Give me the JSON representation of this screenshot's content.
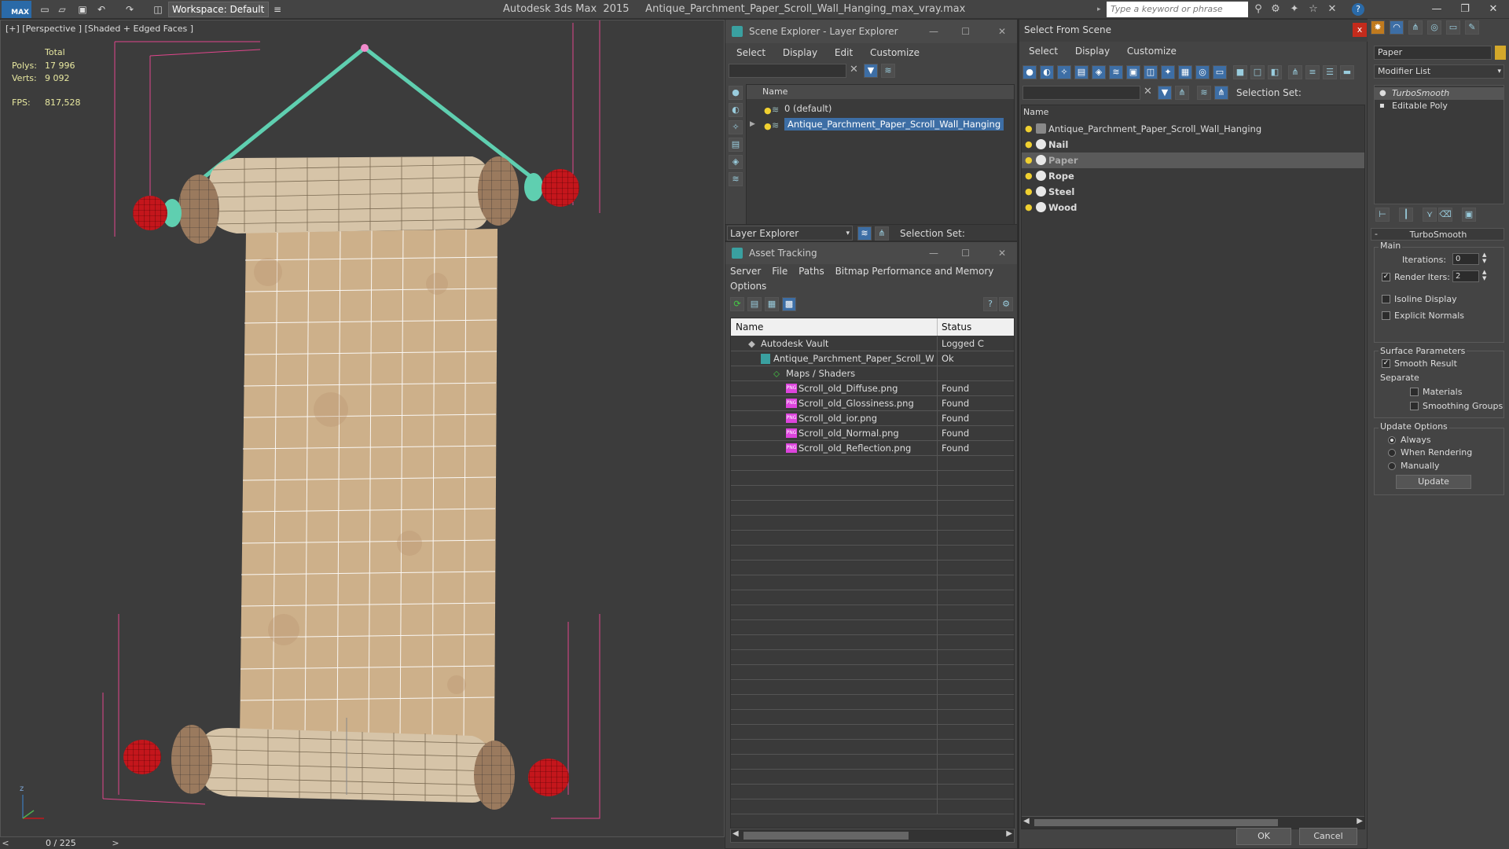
{
  "titlebar": {
    "logo": "MAX",
    "workspace": "Workspace: Default",
    "title": "Autodesk 3ds Max  2015     Antique_Parchment_Paper_Scroll_Wall_Hanging_max_vray.max",
    "search_placeholder": "Type a keyword or phrase"
  },
  "viewport": {
    "label": "[+] [Perspective ] [Shaded + Edged Faces ]",
    "stats": {
      "total_label": "Total",
      "polys_label": "Polys:",
      "polys_value": "17 996",
      "verts_label": "Verts:",
      "verts_value": "9 092",
      "fps_label": "FPS:",
      "fps_value": "817,528"
    },
    "axis_z": "z",
    "timeline_frame": "0 / 225",
    "timeline_prev": "<",
    "timeline_next": ">"
  },
  "scene_explorer": {
    "title": "Scene Explorer - Layer Explorer",
    "menu": [
      "Select",
      "Display",
      "Edit",
      "Customize"
    ],
    "column": "Name",
    "rows": [
      {
        "label": "0 (default)",
        "selected": false
      },
      {
        "label": "Antique_Parchment_Paper_Scroll_Wall_Hanging",
        "selected": true
      }
    ],
    "footer_dropdown": "Layer Explorer",
    "selection_set_label": "Selection Set:"
  },
  "asset_tracking": {
    "title": "Asset Tracking",
    "menu_row1": [
      "Server",
      "File",
      "Paths",
      "Bitmap Performance and Memory"
    ],
    "menu_row2": [
      "Options"
    ],
    "columns": {
      "name": "Name",
      "status": "Status"
    },
    "rows": [
      {
        "name": "Autodesk Vault",
        "status": "Logged C",
        "indent": 0,
        "icon": "vault-icon"
      },
      {
        "name": "Antique_Parchment_Paper_Scroll_Wall_Hangi...",
        "status": "Ok",
        "indent": 1,
        "icon": "max-file-icon"
      },
      {
        "name": "Maps / Shaders",
        "status": "",
        "indent": 2,
        "icon": "maps-icon"
      },
      {
        "name": "Scroll_old_Diffuse.png",
        "status": "Found",
        "indent": 3,
        "icon": "png-icon"
      },
      {
        "name": "Scroll_old_Glossiness.png",
        "status": "Found",
        "indent": 3,
        "icon": "png-icon"
      },
      {
        "name": "Scroll_old_ior.png",
        "status": "Found",
        "indent": 3,
        "icon": "png-icon"
      },
      {
        "name": "Scroll_old_Normal.png",
        "status": "Found",
        "indent": 3,
        "icon": "png-icon"
      },
      {
        "name": "Scroll_old_Reflection.png",
        "status": "Found",
        "indent": 3,
        "icon": "png-icon"
      }
    ],
    "png_badge": "PNG"
  },
  "select_from_scene": {
    "title": "Select From Scene",
    "close": "x",
    "menu": [
      "Select",
      "Display",
      "Customize"
    ],
    "selection_set_label": "Selection Set:",
    "column": "Name",
    "rows": [
      {
        "label": "Antique_Parchment_Paper_Scroll_Wall_Hanging",
        "bold": false,
        "selected": false,
        "group": true
      },
      {
        "label": "Nail",
        "bold": true,
        "selected": false
      },
      {
        "label": "Paper",
        "bold": true,
        "selected": true
      },
      {
        "label": "Rope",
        "bold": true,
        "selected": false
      },
      {
        "label": "Steel",
        "bold": true,
        "selected": false
      },
      {
        "label": "Wood",
        "bold": true,
        "selected": false
      }
    ],
    "ok": "OK",
    "cancel": "Cancel"
  },
  "command_panel": {
    "object_name": "Paper",
    "object_color": "#d4a82a",
    "modifier_list": "Modifier List",
    "stack": [
      "TurboSmooth",
      "Editable Poly"
    ],
    "rollout_title": "TurboSmooth",
    "rollout_collapse": "-",
    "main_group": "Main",
    "iterations_label": "Iterations:",
    "iterations_value": "0",
    "render_iters_label": "Render Iters:",
    "render_iters_value": "2",
    "render_iters_checked": true,
    "isoline_label": "Isoline Display",
    "explicit_normals_label": "Explicit Normals",
    "surface_group": "Surface Parameters",
    "smooth_result_label": "Smooth Result",
    "separate_label": "Separate",
    "materials_label": "Materials",
    "smoothing_groups_label": "Smoothing Groups",
    "update_group": "Update Options",
    "always_label": "Always",
    "when_rendering_label": "When Rendering",
    "manually_label": "Manually",
    "update_button": "Update"
  },
  "colors": {
    "accent": "#3d6ea5",
    "rope": "#5fcfb0",
    "paper": "#cdb08a",
    "knob": "#c4161c",
    "selection_box": "#e0468c"
  }
}
